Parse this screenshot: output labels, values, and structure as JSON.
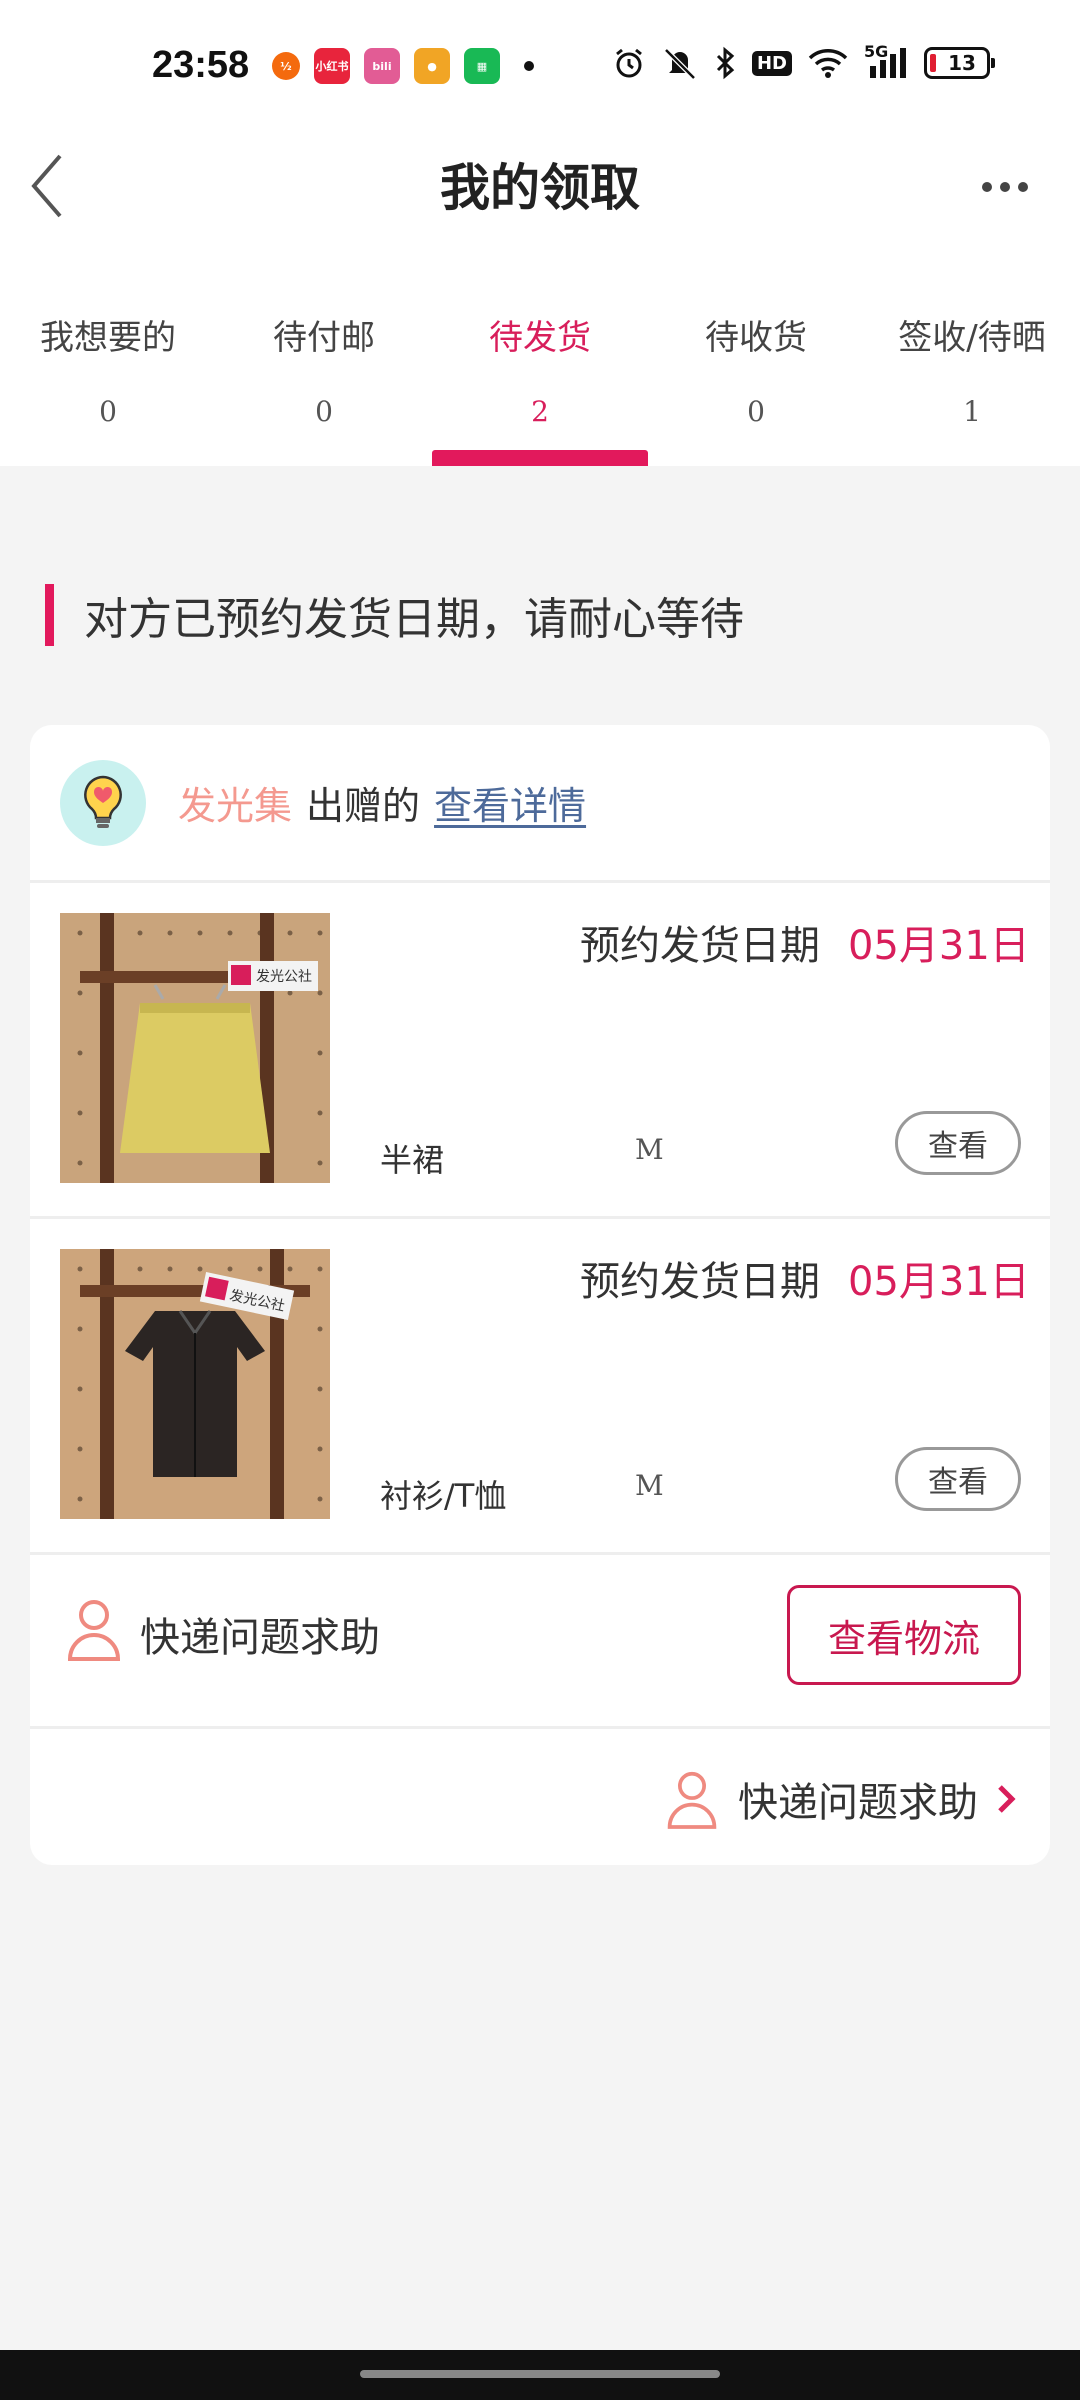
{
  "status": {
    "time": "23:58",
    "apps": [
      {
        "name": "ybx",
        "label": "½",
        "color": "#f46a0e"
      },
      {
        "name": "xiaohongshu",
        "label": "小红书",
        "color": "#e8243c"
      },
      {
        "name": "bilibili",
        "label": "bili",
        "color": "#e25c95"
      },
      {
        "name": "taobao-app",
        "label": "●",
        "color": "#f1a525"
      },
      {
        "name": "wechat-mini",
        "label": "▦",
        "color": "#19b955"
      }
    ],
    "hd": "HD",
    "network": "5G",
    "battery": "13"
  },
  "header": {
    "title": "我的领取"
  },
  "tabs": [
    {
      "label": "我想要的",
      "count": "0"
    },
    {
      "label": "待付邮",
      "count": "0"
    },
    {
      "label": "待发货",
      "count": "2"
    },
    {
      "label": "待收货",
      "count": "0"
    },
    {
      "label": "签收/待晒",
      "count": "1"
    }
  ],
  "notice": "对方已预约发货日期，请耐心等待",
  "card": {
    "giver_name": "发光集",
    "giver_suffix": "出赠的",
    "detail_link": "查看详情",
    "items": [
      {
        "ship_label": "预约发货日期",
        "ship_date": "05月31日",
        "name": "半裙",
        "size": "M",
        "view": "查看",
        "color": "#dccb63",
        "brand": "发光公社"
      },
      {
        "ship_label": "预约发货日期",
        "ship_date": "05月31日",
        "name": "衬衫/T恤",
        "size": "M",
        "view": "查看",
        "color": "#2b2523",
        "brand": "发光公社"
      }
    ],
    "help_text": "快递问题求助",
    "logistics_button": "查看物流",
    "footer_help": "快递问题求助"
  }
}
